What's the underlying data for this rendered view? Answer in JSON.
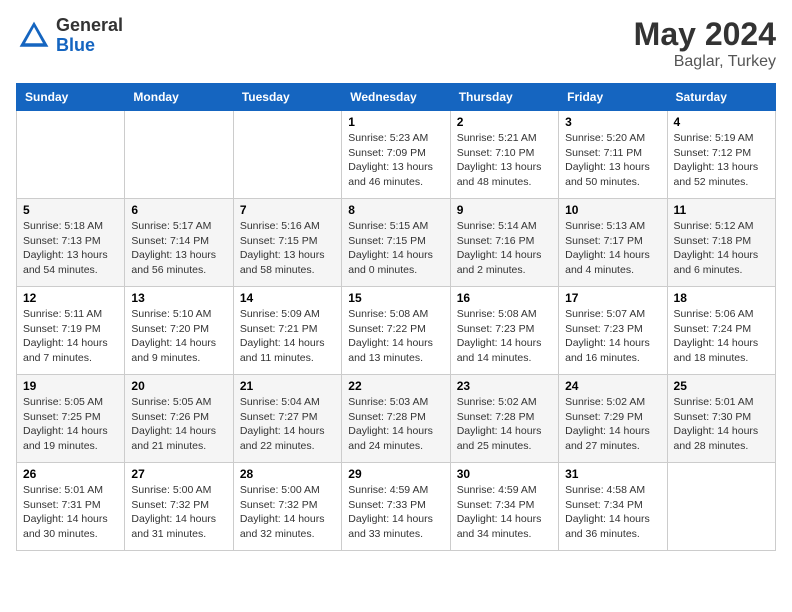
{
  "header": {
    "logo_general": "General",
    "logo_blue": "Blue",
    "month_year": "May 2024",
    "location": "Baglar, Turkey"
  },
  "days_of_week": [
    "Sunday",
    "Monday",
    "Tuesday",
    "Wednesday",
    "Thursday",
    "Friday",
    "Saturday"
  ],
  "weeks": [
    [
      {
        "day": "",
        "info": ""
      },
      {
        "day": "",
        "info": ""
      },
      {
        "day": "",
        "info": ""
      },
      {
        "day": "1",
        "info": "Sunrise: 5:23 AM\nSunset: 7:09 PM\nDaylight: 13 hours\nand 46 minutes."
      },
      {
        "day": "2",
        "info": "Sunrise: 5:21 AM\nSunset: 7:10 PM\nDaylight: 13 hours\nand 48 minutes."
      },
      {
        "day": "3",
        "info": "Sunrise: 5:20 AM\nSunset: 7:11 PM\nDaylight: 13 hours\nand 50 minutes."
      },
      {
        "day": "4",
        "info": "Sunrise: 5:19 AM\nSunset: 7:12 PM\nDaylight: 13 hours\nand 52 minutes."
      }
    ],
    [
      {
        "day": "5",
        "info": "Sunrise: 5:18 AM\nSunset: 7:13 PM\nDaylight: 13 hours\nand 54 minutes."
      },
      {
        "day": "6",
        "info": "Sunrise: 5:17 AM\nSunset: 7:14 PM\nDaylight: 13 hours\nand 56 minutes."
      },
      {
        "day": "7",
        "info": "Sunrise: 5:16 AM\nSunset: 7:15 PM\nDaylight: 13 hours\nand 58 minutes."
      },
      {
        "day": "8",
        "info": "Sunrise: 5:15 AM\nSunset: 7:15 PM\nDaylight: 14 hours\nand 0 minutes."
      },
      {
        "day": "9",
        "info": "Sunrise: 5:14 AM\nSunset: 7:16 PM\nDaylight: 14 hours\nand 2 minutes."
      },
      {
        "day": "10",
        "info": "Sunrise: 5:13 AM\nSunset: 7:17 PM\nDaylight: 14 hours\nand 4 minutes."
      },
      {
        "day": "11",
        "info": "Sunrise: 5:12 AM\nSunset: 7:18 PM\nDaylight: 14 hours\nand 6 minutes."
      }
    ],
    [
      {
        "day": "12",
        "info": "Sunrise: 5:11 AM\nSunset: 7:19 PM\nDaylight: 14 hours\nand 7 minutes."
      },
      {
        "day": "13",
        "info": "Sunrise: 5:10 AM\nSunset: 7:20 PM\nDaylight: 14 hours\nand 9 minutes."
      },
      {
        "day": "14",
        "info": "Sunrise: 5:09 AM\nSunset: 7:21 PM\nDaylight: 14 hours\nand 11 minutes."
      },
      {
        "day": "15",
        "info": "Sunrise: 5:08 AM\nSunset: 7:22 PM\nDaylight: 14 hours\nand 13 minutes."
      },
      {
        "day": "16",
        "info": "Sunrise: 5:08 AM\nSunset: 7:23 PM\nDaylight: 14 hours\nand 14 minutes."
      },
      {
        "day": "17",
        "info": "Sunrise: 5:07 AM\nSunset: 7:23 PM\nDaylight: 14 hours\nand 16 minutes."
      },
      {
        "day": "18",
        "info": "Sunrise: 5:06 AM\nSunset: 7:24 PM\nDaylight: 14 hours\nand 18 minutes."
      }
    ],
    [
      {
        "day": "19",
        "info": "Sunrise: 5:05 AM\nSunset: 7:25 PM\nDaylight: 14 hours\nand 19 minutes."
      },
      {
        "day": "20",
        "info": "Sunrise: 5:05 AM\nSunset: 7:26 PM\nDaylight: 14 hours\nand 21 minutes."
      },
      {
        "day": "21",
        "info": "Sunrise: 5:04 AM\nSunset: 7:27 PM\nDaylight: 14 hours\nand 22 minutes."
      },
      {
        "day": "22",
        "info": "Sunrise: 5:03 AM\nSunset: 7:28 PM\nDaylight: 14 hours\nand 24 minutes."
      },
      {
        "day": "23",
        "info": "Sunrise: 5:02 AM\nSunset: 7:28 PM\nDaylight: 14 hours\nand 25 minutes."
      },
      {
        "day": "24",
        "info": "Sunrise: 5:02 AM\nSunset: 7:29 PM\nDaylight: 14 hours\nand 27 minutes."
      },
      {
        "day": "25",
        "info": "Sunrise: 5:01 AM\nSunset: 7:30 PM\nDaylight: 14 hours\nand 28 minutes."
      }
    ],
    [
      {
        "day": "26",
        "info": "Sunrise: 5:01 AM\nSunset: 7:31 PM\nDaylight: 14 hours\nand 30 minutes."
      },
      {
        "day": "27",
        "info": "Sunrise: 5:00 AM\nSunset: 7:32 PM\nDaylight: 14 hours\nand 31 minutes."
      },
      {
        "day": "28",
        "info": "Sunrise: 5:00 AM\nSunset: 7:32 PM\nDaylight: 14 hours\nand 32 minutes."
      },
      {
        "day": "29",
        "info": "Sunrise: 4:59 AM\nSunset: 7:33 PM\nDaylight: 14 hours\nand 33 minutes."
      },
      {
        "day": "30",
        "info": "Sunrise: 4:59 AM\nSunset: 7:34 PM\nDaylight: 14 hours\nand 34 minutes."
      },
      {
        "day": "31",
        "info": "Sunrise: 4:58 AM\nSunset: 7:34 PM\nDaylight: 14 hours\nand 36 minutes."
      },
      {
        "day": "",
        "info": ""
      }
    ]
  ]
}
